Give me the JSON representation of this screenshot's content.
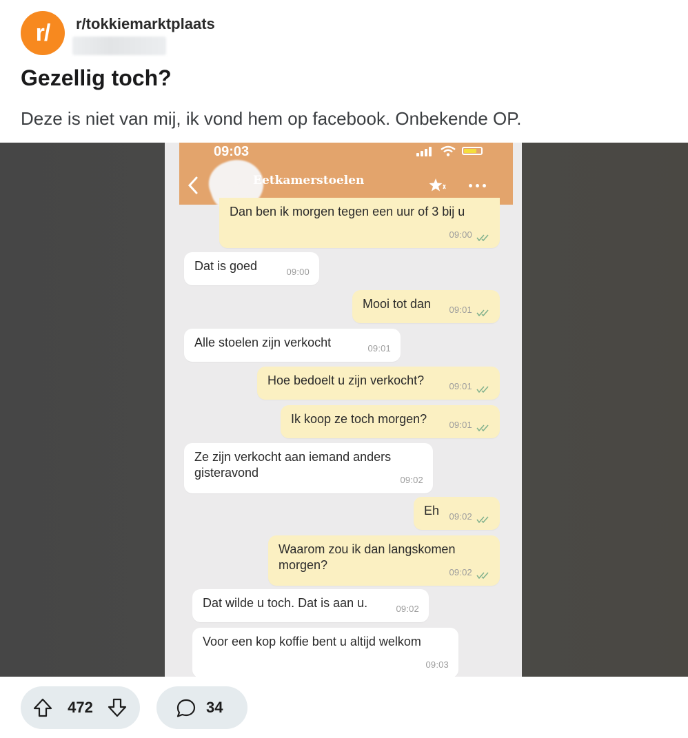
{
  "subreddit": {
    "avatar_text": "r/",
    "name": "r/tokkiemarktplaats",
    "brand_color": "#f7891f"
  },
  "post": {
    "title": "Gezellig toch?",
    "body": "Deze is niet van mij, ik vond hem op facebook. Onbekende OP."
  },
  "screenshot": {
    "status_time": "09:03",
    "chat_title": "Eetkamerstoelen",
    "header_color": "#e3a46c",
    "messages": [
      {
        "dir": "out",
        "text": "Dan ben ik morgen tegen een uur of 3 bij u",
        "time": "09:00"
      },
      {
        "dir": "in",
        "text": "Dat is goed",
        "time": "09:00"
      },
      {
        "dir": "out",
        "text": "Mooi tot dan",
        "time": "09:01"
      },
      {
        "dir": "in",
        "text": "Alle stoelen zijn verkocht",
        "time": "09:01"
      },
      {
        "dir": "out",
        "text": "Hoe bedoelt u zijn verkocht?",
        "time": "09:01"
      },
      {
        "dir": "out",
        "text": "Ik koop ze toch morgen?",
        "time": "09:01"
      },
      {
        "dir": "in",
        "text": "Ze zijn verkocht aan iemand anders gisteravond",
        "time": "09:02"
      },
      {
        "dir": "out",
        "text": "Eh",
        "time": "09:02"
      },
      {
        "dir": "out",
        "text": "Waarom zou ik dan langskomen morgen?",
        "time": "09:02"
      },
      {
        "dir": "in",
        "text": "Dat wilde u toch. Dat is aan u.",
        "time": "09:02"
      },
      {
        "dir": "in",
        "text": "Voor een kop koffie bent u altijd welkom",
        "time": "09:03"
      }
    ]
  },
  "actions": {
    "vote_count": "472",
    "comment_count": "34"
  }
}
